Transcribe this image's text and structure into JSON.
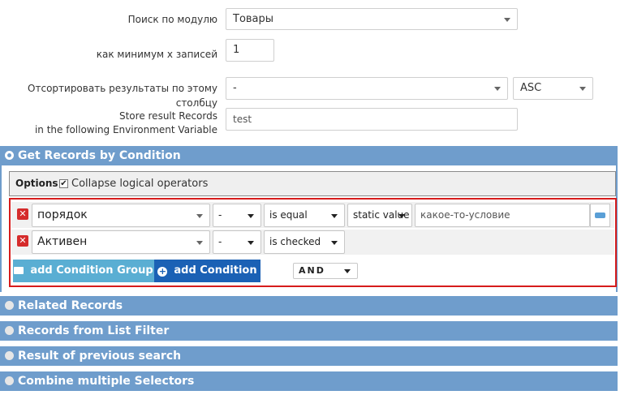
{
  "form": {
    "module_label": "Поиск по модулю",
    "module_value": "Товары",
    "min_label": "как минимум x записей",
    "min_value": "1",
    "sort_label": "Отсортировать результаты по этому столбцу",
    "sort_value": "-",
    "order_value": "ASC",
    "store_label_1": "Store result Records",
    "store_label_2": "in the following Environment Variable",
    "store_value": "test"
  },
  "sections": {
    "get_records": "Get Records by Condition",
    "related": "Related Records",
    "list_filter": "Records from List Filter",
    "previous": "Result of previous search",
    "combine": "Combine multiple Selectors"
  },
  "options": {
    "label": "Options:",
    "collapse_label": "Collapse logical operators",
    "collapse_checked": true
  },
  "conditions": [
    {
      "field": "порядок",
      "modifier": "-",
      "operator": "is equal",
      "value_type": "static value",
      "value": "какое-то-условие"
    },
    {
      "field": "Активен",
      "modifier": "-",
      "operator": "is checked"
    }
  ],
  "actions": {
    "add_group": "add Condition Group",
    "add_condition": "add Condition",
    "logic": "AND"
  },
  "colors": {
    "section_bg": "#6f9dcc",
    "add_group_bg": "#5aaed3",
    "add_condition_bg": "#1b61b5",
    "border_highlight": "#d61c1c",
    "remove_button": "#d52b2b"
  },
  "icons": {
    "remove": "close-icon",
    "folder": "folder-open-icon",
    "plus": "plus-circle-icon",
    "toggle": "toggle-icon",
    "checkbox": "checkbox-checked-icon",
    "radio": "radio-icon"
  }
}
